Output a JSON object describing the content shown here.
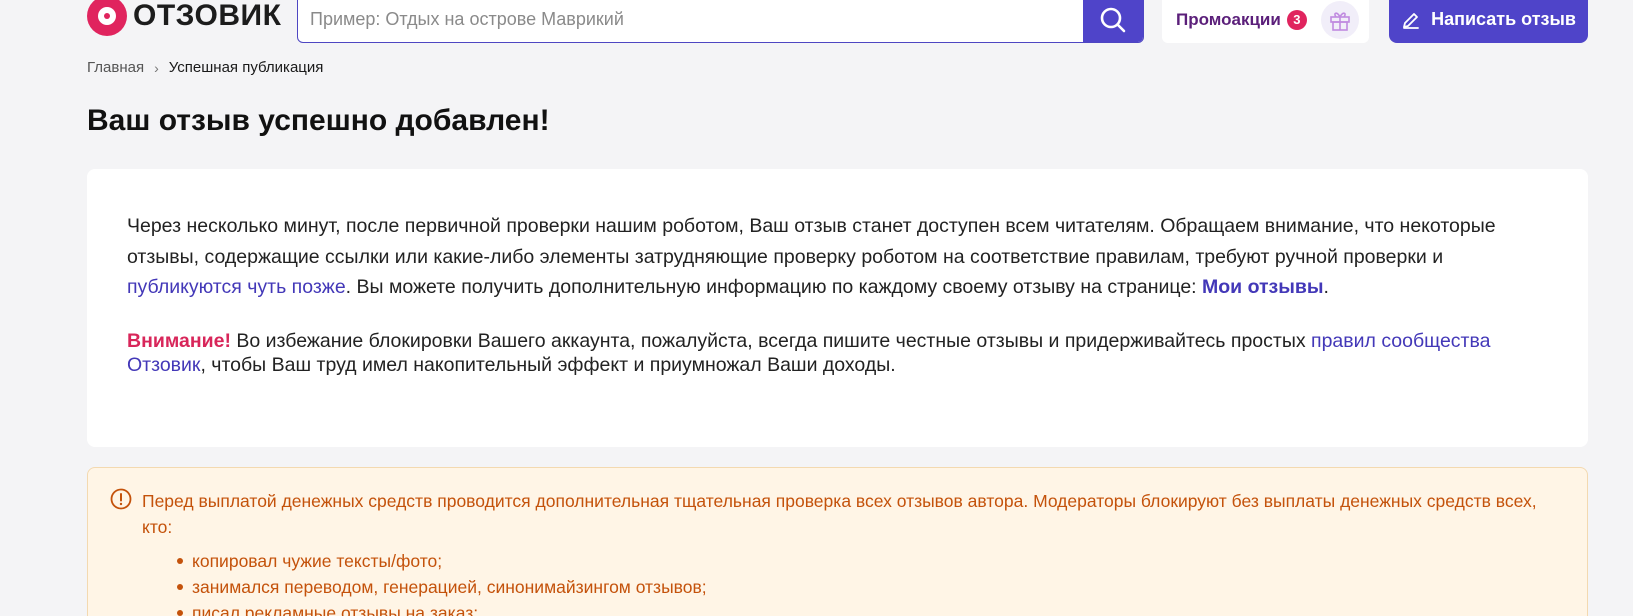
{
  "header": {
    "logo_text": "ОТЗОВИК",
    "search_placeholder": "Пример: Отдых на острове Маврикий",
    "promo_label": "Промоакции",
    "promo_count": "3",
    "write_label": "Написать отзыв"
  },
  "breadcrumb": {
    "home": "Главная",
    "separator": "›",
    "current": "Успешная публикация"
  },
  "title": "Ваш отзыв успешно добавлен!",
  "card": {
    "p1_part1": "Через несколько минут, после первичной проверки нашим роботом, Ваш отзыв станет доступен всем читателям. Обращаем внимание, что некоторые отзывы, содержащие ссылки или какие-либо элементы затрудняющие проверку роботом на соответствие правилам, требуют ручной проверки и ",
    "p1_link": "публикуются чуть позже",
    "p1_part2": ". Вы можете получить дополнительную информацию по каждому своему отзыву на странице: ",
    "p1_my_reviews": "Мои отзывы",
    "p1_end": ".",
    "warning_label": "Внимание!",
    "warning_part1": " Во избежание блокировки Вашего аккаунта, пожалуйста, всегда пишите честные отзывы и придерживайтесь простых ",
    "warning_link": "правил сообщества Отзовик",
    "warning_part2": ", чтобы Ваш труд имел накопительный эффект и приумножал Ваши доходы."
  },
  "notice": {
    "text": "Перед выплатой денежных средств проводится дополнительная тщательная проверка всех отзывов автора. Модераторы блокируют без выплаты денежных средств всех, кто:",
    "items": [
      "копировал чужие тексты/фото;",
      "занимался переводом, генерацией, синонимайзингом отзывов;",
      "писал рекламные отзывы на заказ;"
    ]
  },
  "colors": {
    "brand": "#e0245e",
    "accent": "#4f44c9",
    "notice_text": "#c4520b",
    "notice_bg": "#fff5e6"
  }
}
